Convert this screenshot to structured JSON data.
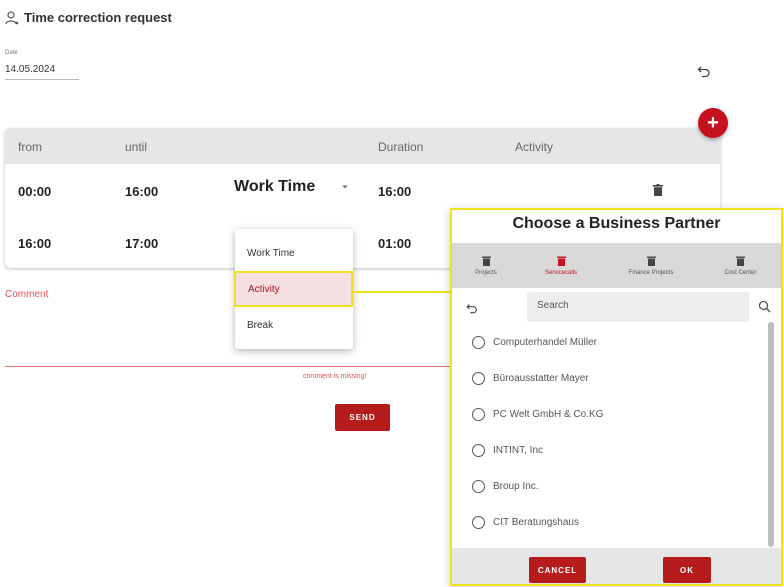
{
  "header": {
    "title": "Time correction request",
    "title_icon": "person-icon"
  },
  "date_field": {
    "label": "Date",
    "value": "14.05.2024"
  },
  "add_button": {
    "label": "+"
  },
  "table": {
    "headers": [
      "from",
      "until",
      "Duration",
      "Activity"
    ],
    "rows": [
      {
        "from": "00:00",
        "until": "16:00",
        "type": "Work Time",
        "duration": "16:00"
      },
      {
        "from": "16:00",
        "until": "17:00",
        "type": "",
        "duration": "01:00"
      }
    ]
  },
  "type_dropdown": {
    "options": [
      "Work Time",
      "Activity",
      "Break"
    ],
    "highlighted": "Activity"
  },
  "comment": {
    "label": "Comment",
    "error": "comment is missing!"
  },
  "send_label": "SEND",
  "business_partner_dialog": {
    "title": "Choose a Business Partner",
    "tabs": [
      {
        "label": "Projects",
        "icon": "trash-icon"
      },
      {
        "label": "Servicecalls",
        "icon": "trash-icon",
        "active": true
      },
      {
        "label": "Finance Projects",
        "icon": "trash-icon"
      },
      {
        "label": "Cost Center",
        "icon": "trash-icon"
      }
    ],
    "search_placeholder": "Search",
    "partners": [
      "Computerhandel Müller",
      "Büroausstatter Mayer",
      "PC Welt GmbH & Co.KG",
      "INTINT, Inc",
      "Broup Inc.",
      "CIT Beratungshaus"
    ],
    "cancel_label": "CANCEL",
    "ok_label": "OK"
  },
  "colors": {
    "accent": "#c5121e",
    "highlight": "#f0e020",
    "error": "#e0514d"
  }
}
